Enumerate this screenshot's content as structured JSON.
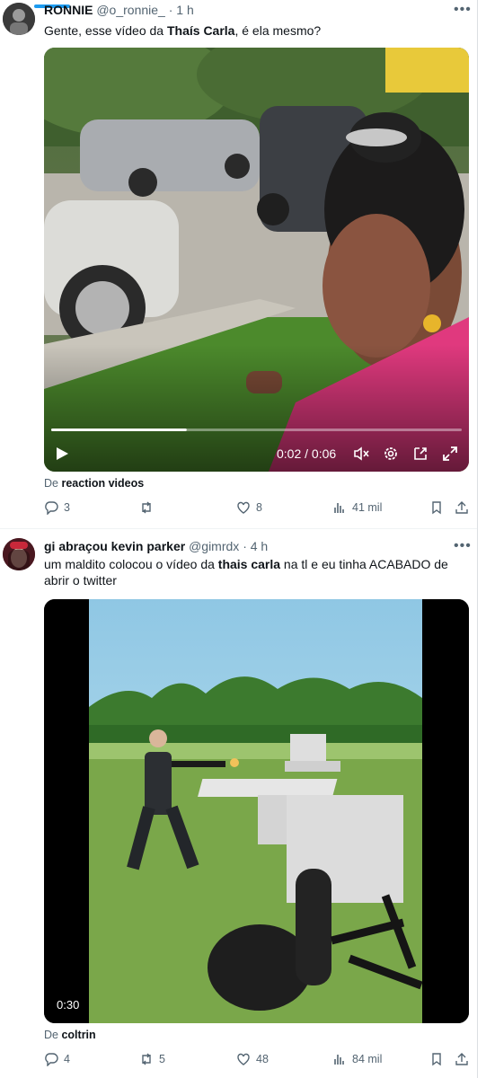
{
  "tweet1": {
    "name": "RONNIE",
    "handle": "@o_ronnie_",
    "time": "1 h",
    "text_before": "Gente, esse vídeo da ",
    "text_bold": "Thaís Carla",
    "text_after": ", é ela mesmo?",
    "video_time": "0:02 / 0:06",
    "video_progress": 0.33,
    "source_prefix": "De",
    "source_name": "reaction videos",
    "replies": "3",
    "retweets": "",
    "likes": "8",
    "views": "41 mil"
  },
  "tweet2": {
    "name": "gi abraçou kevin parker",
    "handle": "@gimrdx",
    "time": "4 h",
    "text_before": "um maldito colocou o vídeo da ",
    "text_bold": "thais carla",
    "text_after": " na tl e eu tinha ACABADO de abrir o twitter",
    "video_duration": "0:30",
    "source_prefix": "De",
    "source_name": "coltrin",
    "replies": "4",
    "retweets": "5",
    "likes": "48",
    "views": "84 mil"
  },
  "colors": {
    "accent": "#1d9bf0",
    "secondary_text": "#536471",
    "video_top": "#3a5a2a",
    "shirt": "#e0397e"
  },
  "icons": [
    "more-icon",
    "reply-icon",
    "retweet-icon",
    "like-icon",
    "views-icon",
    "bookmark-icon",
    "share-icon",
    "play-icon",
    "mute-icon",
    "settings-icon",
    "pip-icon",
    "fullscreen-icon"
  ]
}
